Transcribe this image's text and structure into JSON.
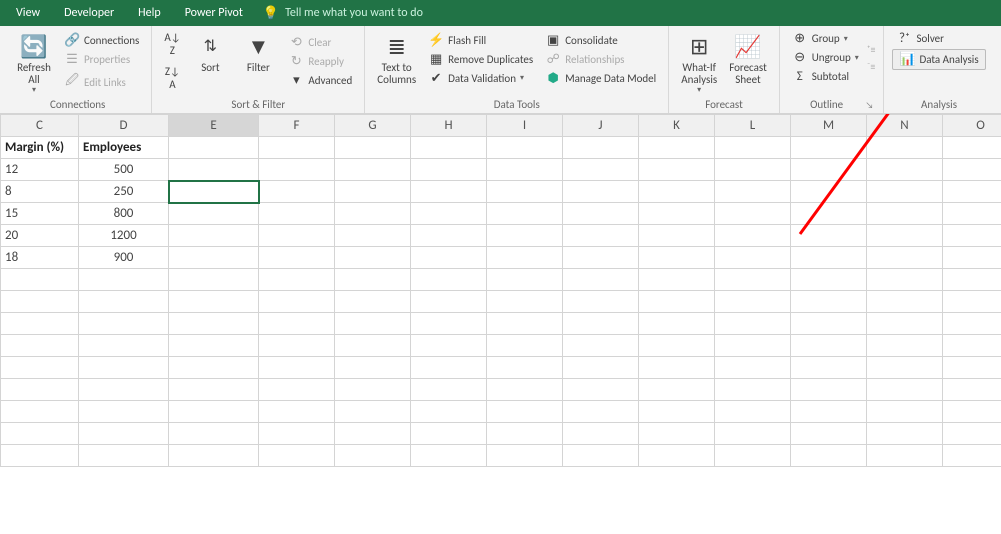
{
  "menu": {
    "view": "View",
    "developer": "Developer",
    "help": "Help",
    "powerpivot": "Power Pivot",
    "tellme": "Tell me what you want to do"
  },
  "ribbon": {
    "refreshAll": "Refresh\nAll",
    "connections": "Connections",
    "properties": "Properties",
    "editLinks": "Edit Links",
    "groupConnections": "Connections",
    "sort": "Sort",
    "filter": "Filter",
    "clear": "Clear",
    "reapply": "Reapply",
    "advanced": "Advanced",
    "groupSortFilter": "Sort & Filter",
    "textToColumns": "Text to\nColumns",
    "flashFill": "Flash Fill",
    "removeDuplicates": "Remove Duplicates",
    "dataValidation": "Data Validation",
    "consolidate": "Consolidate",
    "relationships": "Relationships",
    "manageDataModel": "Manage Data Model",
    "groupDataTools": "Data Tools",
    "whatIf": "What-If\nAnalysis",
    "forecastSheet": "Forecast\nSheet",
    "groupForecast": "Forecast",
    "group": "Group",
    "ungroup": "Ungroup",
    "subtotal": "Subtotal",
    "groupOutline": "Outline",
    "solver": "Solver",
    "dataAnalysis": "Data Analysis",
    "groupAnalysis": "Analysis"
  },
  "columns": [
    "C",
    "D",
    "E",
    "F",
    "G",
    "H",
    "I",
    "J",
    "K",
    "L",
    "M",
    "N",
    "O"
  ],
  "data": {
    "hdrC": "Margin (%)",
    "hdrD": "Employees",
    "r1c": "12",
    "r1d": "500",
    "r2c": "8",
    "r2d": "250",
    "r3c": "15",
    "r3d": "800",
    "r4c": "20",
    "r4d": "1200",
    "r5c": "18",
    "r5d": "900"
  }
}
